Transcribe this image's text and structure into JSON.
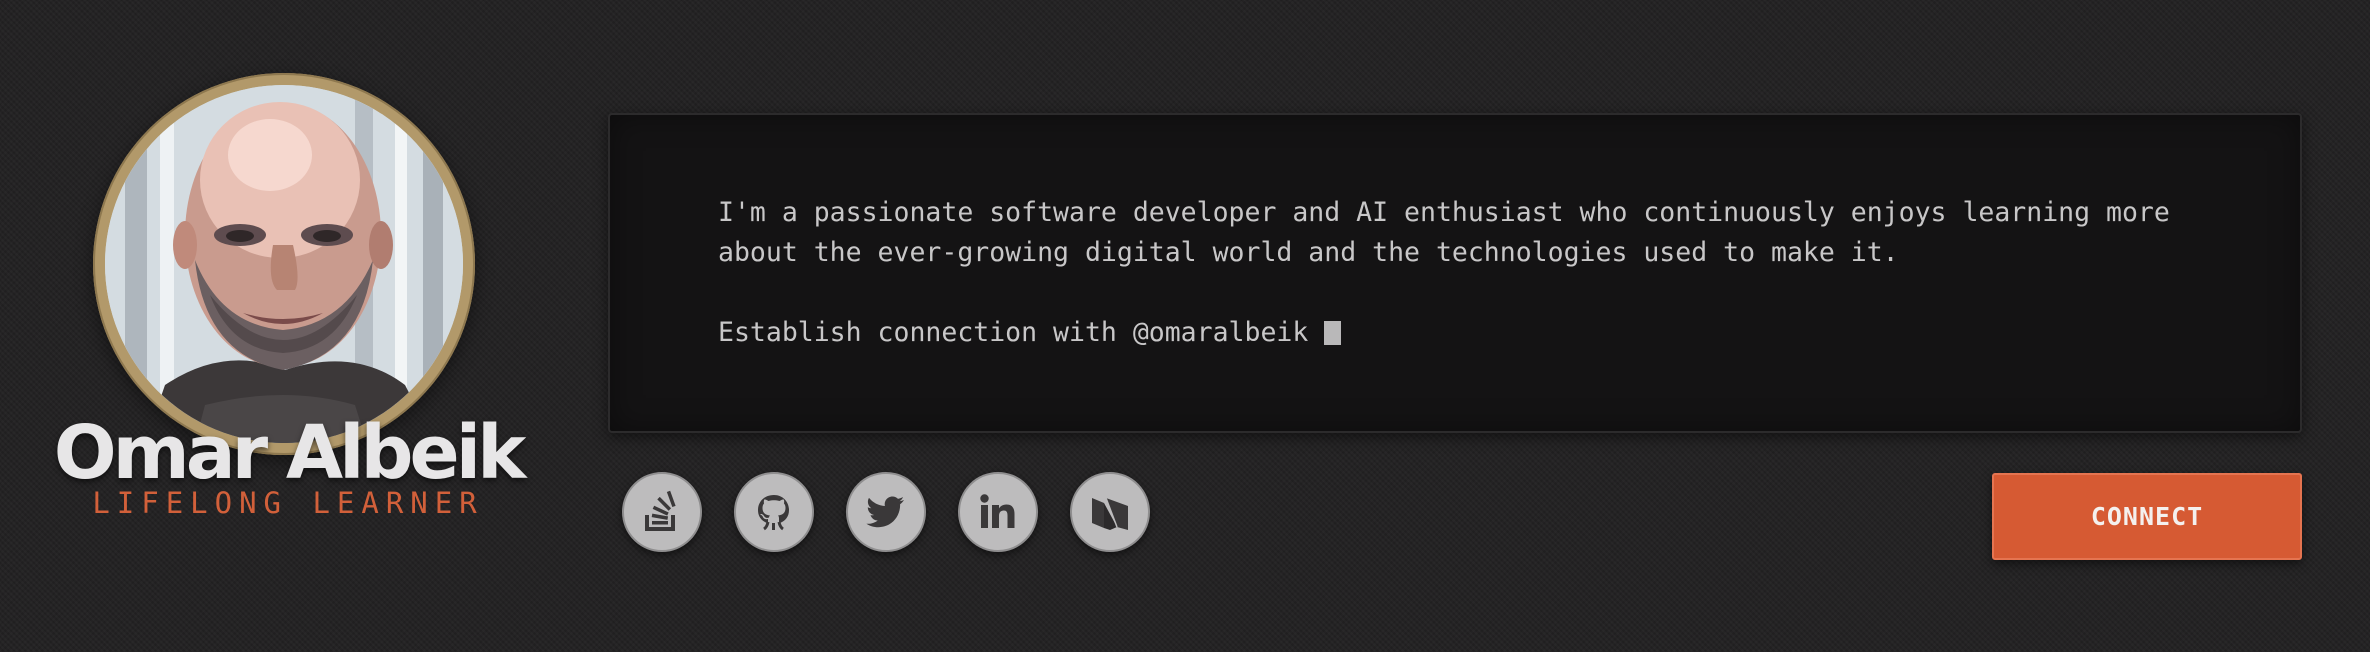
{
  "profile": {
    "name": "Omar Albeik",
    "tagline": "LIFELONG LEARNER",
    "avatar_icon": "profile-photo",
    "ring_color": "#b2996a",
    "tagline_color": "#d2603a"
  },
  "terminal": {
    "bio": "I'm a passionate software developer and AI enthusiast who continuously enjoys learning more\nabout the ever-growing digital world and the technologies used to make it.",
    "prompt": "Establish connection with @omaralbeik"
  },
  "social": [
    {
      "name": "stack-overflow",
      "icon": "stack-overflow-icon"
    },
    {
      "name": "github",
      "icon": "github-icon"
    },
    {
      "name": "twitter",
      "icon": "twitter-icon"
    },
    {
      "name": "linkedin",
      "icon": "linkedin-icon"
    },
    {
      "name": "medium",
      "icon": "medium-icon"
    }
  ],
  "connect": {
    "label": "CONNECT",
    "color": "#d65a33"
  }
}
